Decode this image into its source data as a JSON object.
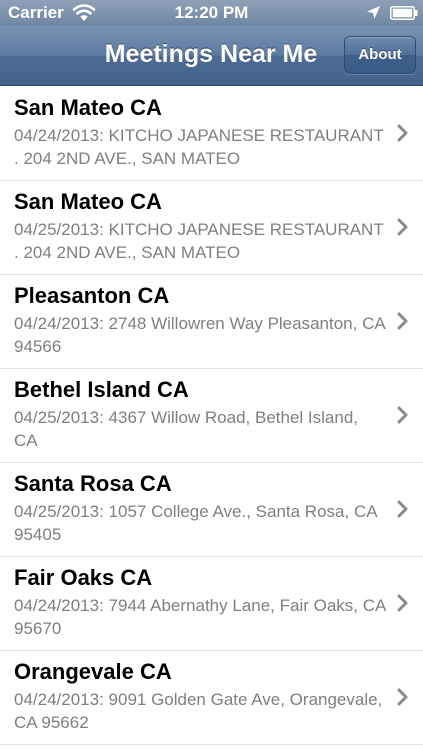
{
  "status_bar": {
    "carrier": "Carrier",
    "time": "12:20 PM",
    "icons": [
      "wifi-icon",
      "location-icon",
      "battery-icon"
    ]
  },
  "nav_bar": {
    "title": "Meetings Near Me",
    "about_label": "About"
  },
  "colors": {
    "nav_bar": "#5c7aa0",
    "status_bar": "#7a8fa9",
    "detail_text": "#7f7f7f",
    "separator": "#e0e0e0",
    "chevron": "#8a8a8a"
  },
  "meetings": [
    {
      "title": "San Mateo CA",
      "detail": "04/24/2013: KITCHO JAPANESE RESTAURANT . 204 2ND AVE., SAN MATEO"
    },
    {
      "title": "San Mateo CA",
      "detail": "04/25/2013: KITCHO JAPANESE RESTAURANT . 204 2ND AVE., SAN MATEO"
    },
    {
      "title": "Pleasanton CA",
      "detail": "04/24/2013: 2748 Willowren Way Pleasanton, CA 94566"
    },
    {
      "title": "Bethel Island CA",
      "detail": "04/25/2013: 4367 Willow Road, Bethel Island, CA"
    },
    {
      "title": "Santa Rosa CA",
      "detail": "04/25/2013: 1057 College Ave., Santa Rosa, CA  95405"
    },
    {
      "title": "Fair Oaks CA",
      "detail": "04/24/2013: 7944 Abernathy Lane, Fair Oaks, CA 95670"
    },
    {
      "title": "Orangevale CA",
      "detail": "04/24/2013: 9091 Golden Gate Ave, Orangevale, CA 95662"
    }
  ]
}
